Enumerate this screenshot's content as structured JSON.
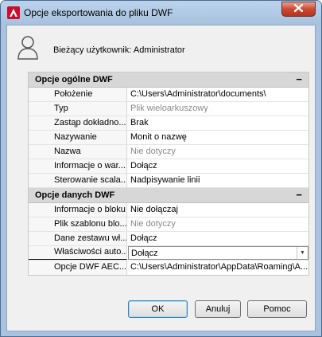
{
  "window": {
    "title": "Opcje eksportowania do pliku DWF"
  },
  "user": {
    "label": "Bieżący użytkownik: Administrator"
  },
  "sections": [
    {
      "title": "Opcje ogólne DWF",
      "collapse": "−",
      "rows": [
        {
          "key": "Położenie",
          "value": "C:\\Users\\Administrator\\documents\\"
        },
        {
          "key": "Typ",
          "value": "Plik wieloarkuszowy"
        },
        {
          "key": "Zastąp dokładno...",
          "value": "Brak"
        },
        {
          "key": "Nazywanie",
          "value": "Monit o nazwę"
        },
        {
          "key": "Nazwa",
          "value": "Nie dotyczy"
        },
        {
          "key": "Informacje o war...",
          "value": "Dołącz"
        },
        {
          "key": "Sterowanie scala...",
          "value": "Nadpisywanie linii"
        }
      ]
    },
    {
      "title": "Opcje danych DWF",
      "collapse": "−",
      "rows": [
        {
          "key": "Informacje o bloku",
          "value": "Nie dołączaj"
        },
        {
          "key": "Plik szablonu blo...",
          "value": "Nie dotyczy"
        },
        {
          "key": "Dane zestawu wł...",
          "value": "Dołącz"
        },
        {
          "key": "Właściwości auto...",
          "value": "Dołącz"
        },
        {
          "key": "Opcje DWF AEC...",
          "value": "C:\\Users\\Administrator\\AppData\\Roaming\\A..."
        }
      ]
    }
  ],
  "buttons": {
    "ok": "OK",
    "cancel": "Anuluj",
    "help": "Pomoc"
  }
}
